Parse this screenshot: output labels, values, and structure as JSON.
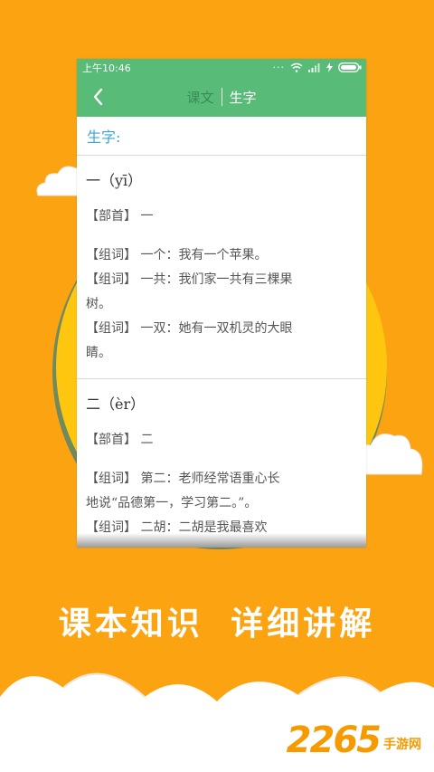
{
  "statusbar": {
    "time": "上午10:46"
  },
  "toolbar": {
    "tabs": [
      {
        "label": "课文"
      },
      {
        "label": "生字"
      }
    ]
  },
  "section": {
    "title": "生字:"
  },
  "entries": [
    {
      "head": "一（yī）",
      "radical": "【部首】 一",
      "words": [
        "【组词】 一个：我有一个苹果。",
        "【组词】 一共：我们家一共有三棵果",
        "树。",
        "【组词】 一双：她有一双机灵的大眼",
        "睛。"
      ]
    },
    {
      "head": "二（èr）",
      "radical": "【部首】 二",
      "words": [
        "【组词】 第二：老师经常语重心长",
        "地说“品德第一，学习第二。”。",
        "【组词】 二胡：二胡是我最喜欢"
      ]
    }
  ],
  "slogan": "课本知识 详细讲解",
  "watermark": {
    "number": "2265",
    "text": "手游网"
  },
  "colors": {
    "background": "#FCA312",
    "header_green": "#58BB78",
    "section_blue": "#3aa4d8",
    "circle_yellow": "#FFC60F"
  }
}
